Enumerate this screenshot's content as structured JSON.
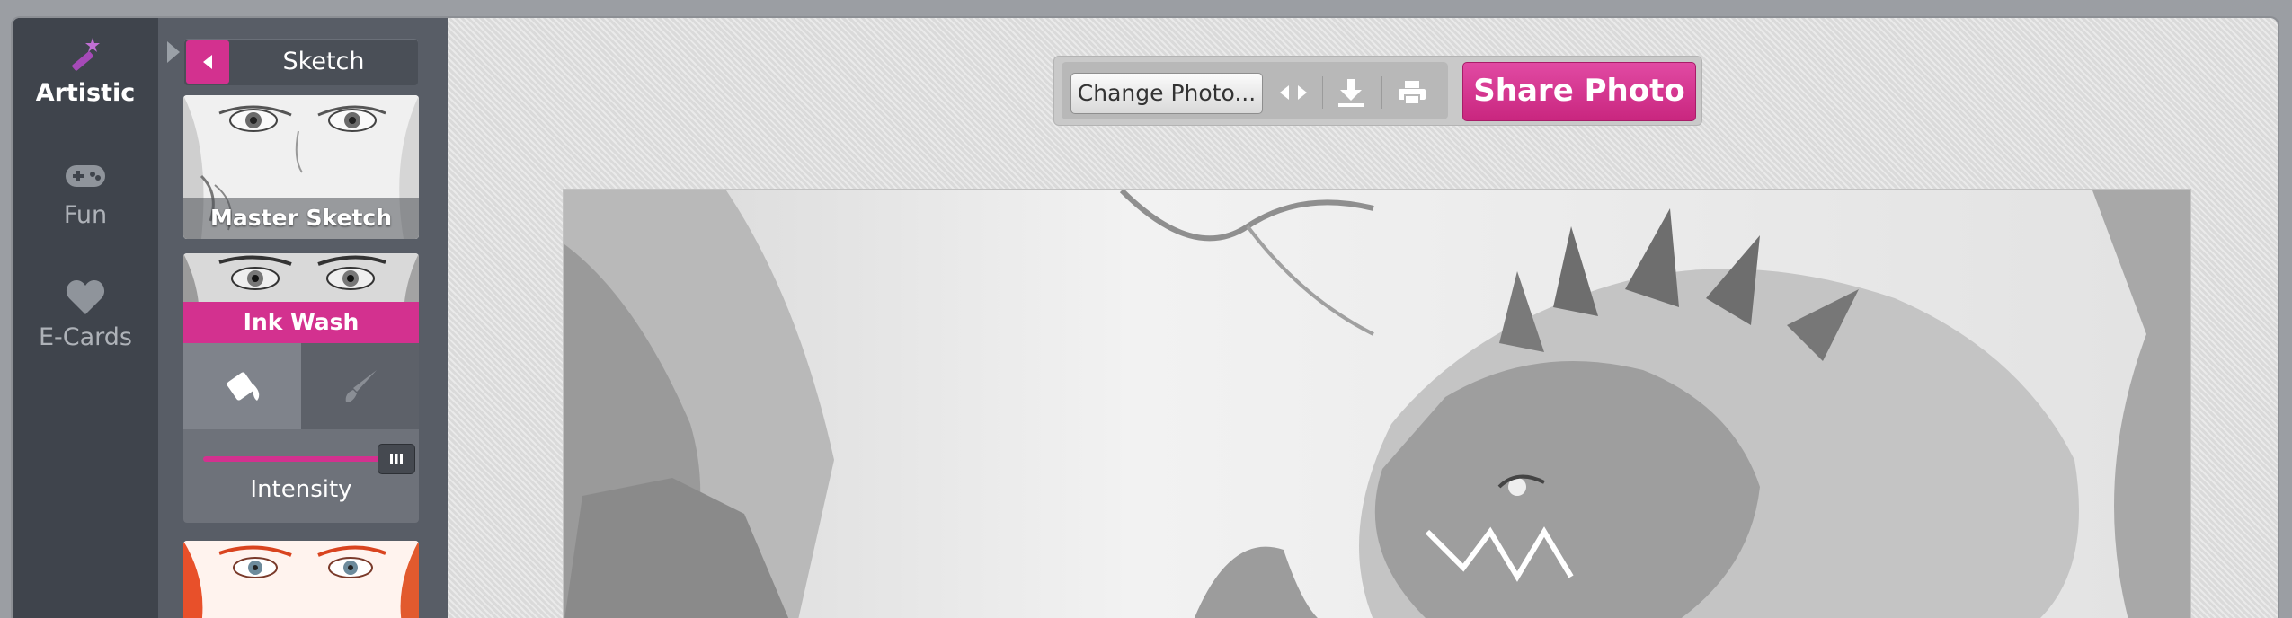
{
  "categories": [
    {
      "label": "Artistic",
      "icon": "magic-wand-icon",
      "active": true
    },
    {
      "label": "Fun",
      "icon": "gamepad-icon",
      "active": false
    },
    {
      "label": "E-Cards",
      "icon": "heart-icon",
      "active": false
    }
  ],
  "filters": {
    "header_title": "Sketch",
    "items": [
      {
        "label": "Master Sketch",
        "selected": false
      },
      {
        "label": "Ink Wash",
        "selected": true
      },
      {
        "label": "",
        "selected": false
      }
    ],
    "intensity_label": "Intensity",
    "intensity_value": 1.0
  },
  "toolbar": {
    "change_photo_label": "Change Photo...",
    "share_label": "Share Photo",
    "icons": [
      "compare-icon",
      "download-icon",
      "print-icon"
    ]
  },
  "colors": {
    "accent": "#d3318f",
    "rail_bg": "#3f444c",
    "panel_bg": "#585d66",
    "workspace_bg": "#dedede"
  }
}
